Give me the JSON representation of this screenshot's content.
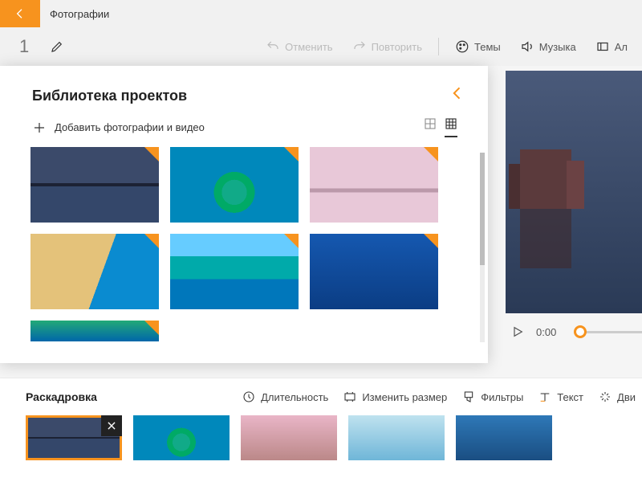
{
  "header": {
    "app_title": "Фотографии",
    "project_number": "1"
  },
  "toolbar": {
    "undo": "Отменить",
    "redo": "Повторить",
    "themes": "Темы",
    "music": "Музыка",
    "aspect": "Ал"
  },
  "library": {
    "title": "Библиотека проектов",
    "add_label": "Добавить фотографии и видео"
  },
  "preview": {
    "time": "0:00"
  },
  "storyboard": {
    "title": "Раскадровка",
    "duration": "Длительность",
    "resize": "Изменить размер",
    "filters": "Фильтры",
    "text": "Текст",
    "motion": "Дви"
  }
}
